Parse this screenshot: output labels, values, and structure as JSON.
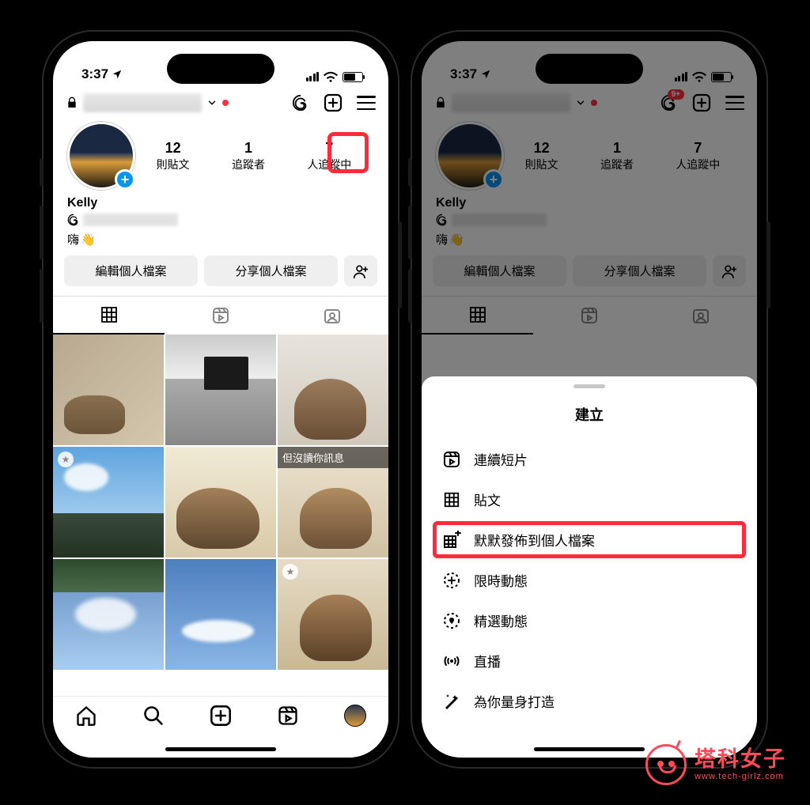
{
  "status": {
    "time": "3:37"
  },
  "topbar": {
    "notify_badge": "9+"
  },
  "profile": {
    "name": "Kelly",
    "bio_text": "嗨",
    "bio_emoji": "👋",
    "stats": {
      "posts": {
        "value": "12",
        "label": "則貼文"
      },
      "followers": {
        "value": "1",
        "label": "追蹤者"
      },
      "following": {
        "value": "7",
        "label": "人追蹤中"
      }
    },
    "buttons": {
      "edit": "編輯個人檔案",
      "share": "分享個人檔案"
    }
  },
  "tiles": {
    "label_6": "但沒讀你訊息"
  },
  "sheet": {
    "title": "建立",
    "items": [
      {
        "icon": "reel-icon",
        "label": "連續短片"
      },
      {
        "icon": "grid-icon",
        "label": "貼文"
      },
      {
        "icon": "grid-plus-icon",
        "label": "默默發佈到個人檔案"
      },
      {
        "icon": "story-icon",
        "label": "限時動態"
      },
      {
        "icon": "highlight-icon",
        "label": "精選動態"
      },
      {
        "icon": "live-icon",
        "label": "直播"
      },
      {
        "icon": "made-for-you-icon",
        "label": "為你量身打造"
      }
    ]
  },
  "watermark": {
    "main": "塔科女子",
    "sub": "www.tech-girlz.com"
  }
}
